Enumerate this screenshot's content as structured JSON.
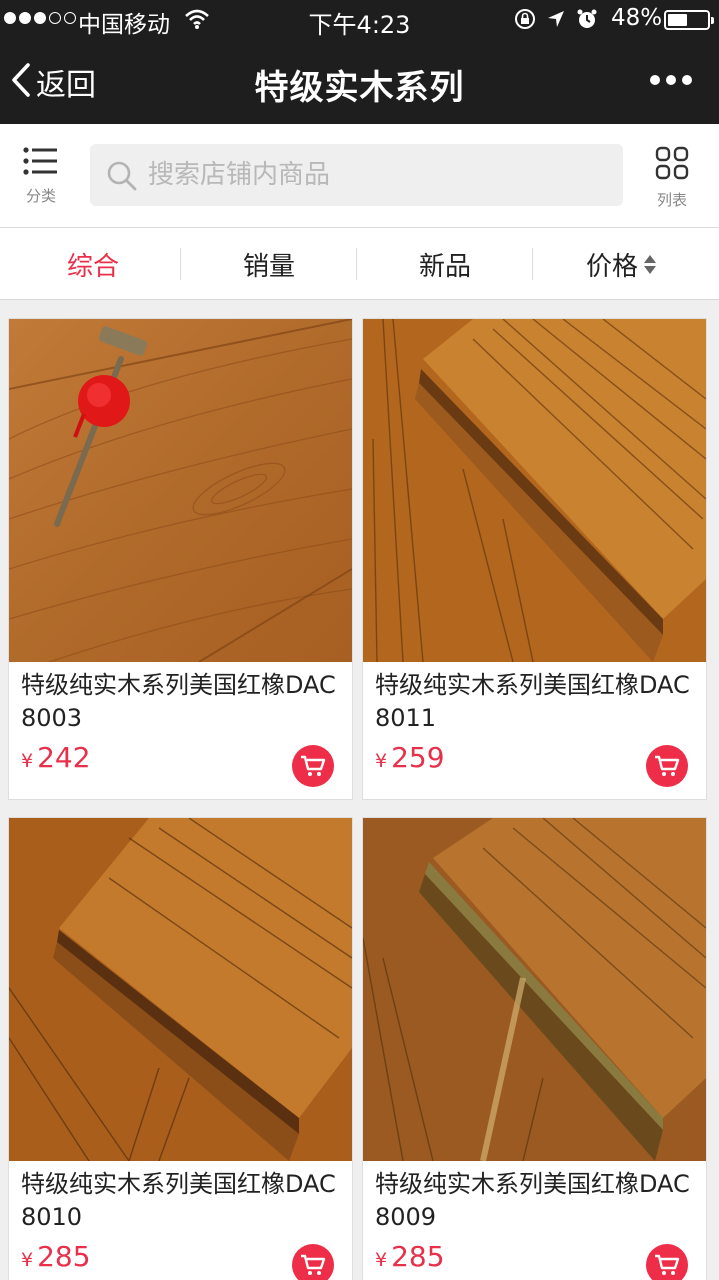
{
  "status_bar": {
    "carrier": "中国移动",
    "time": "下午4:23",
    "battery_percent": "48%",
    "battery_level": 0.48,
    "signal_strength": 3,
    "icons": [
      "signal-dots-icon",
      "wifi-icon",
      "rotation-lock-icon",
      "location-arrow-icon",
      "alarm-icon",
      "battery-icon"
    ]
  },
  "nav": {
    "back_label": "返回",
    "title": "特级实木系列",
    "more_icon": "more-dots-icon"
  },
  "search": {
    "category_label": "分类",
    "placeholder": "搜索店铺内商品",
    "value": "",
    "list_label": "列表"
  },
  "sort_tabs": [
    {
      "label": "综合",
      "active": true
    },
    {
      "label": "销量",
      "active": false
    },
    {
      "label": "新品",
      "active": false
    },
    {
      "label": "价格",
      "active": false
    }
  ],
  "colors": {
    "accent": "#e8304a",
    "header_bg": "#1e1e1e",
    "page_bg": "#efefef"
  },
  "currency_symbol": "¥",
  "products": [
    {
      "name": "特级纯实木系列美国红橡DAC8003",
      "price": "242",
      "image": "wood-floor-with-hammer-photo"
    },
    {
      "name": "特级纯实木系列美国红橡DAC8011",
      "price": "259",
      "image": "wood-plank-edge-photo"
    },
    {
      "name": "特级纯实木系列美国红橡DAC8010",
      "price": "285",
      "image": "wood-plank-edge-photo"
    },
    {
      "name": "特级纯实木系列美国红橡DAC8009",
      "price": "285",
      "image": "wood-plank-edge-photo"
    }
  ]
}
